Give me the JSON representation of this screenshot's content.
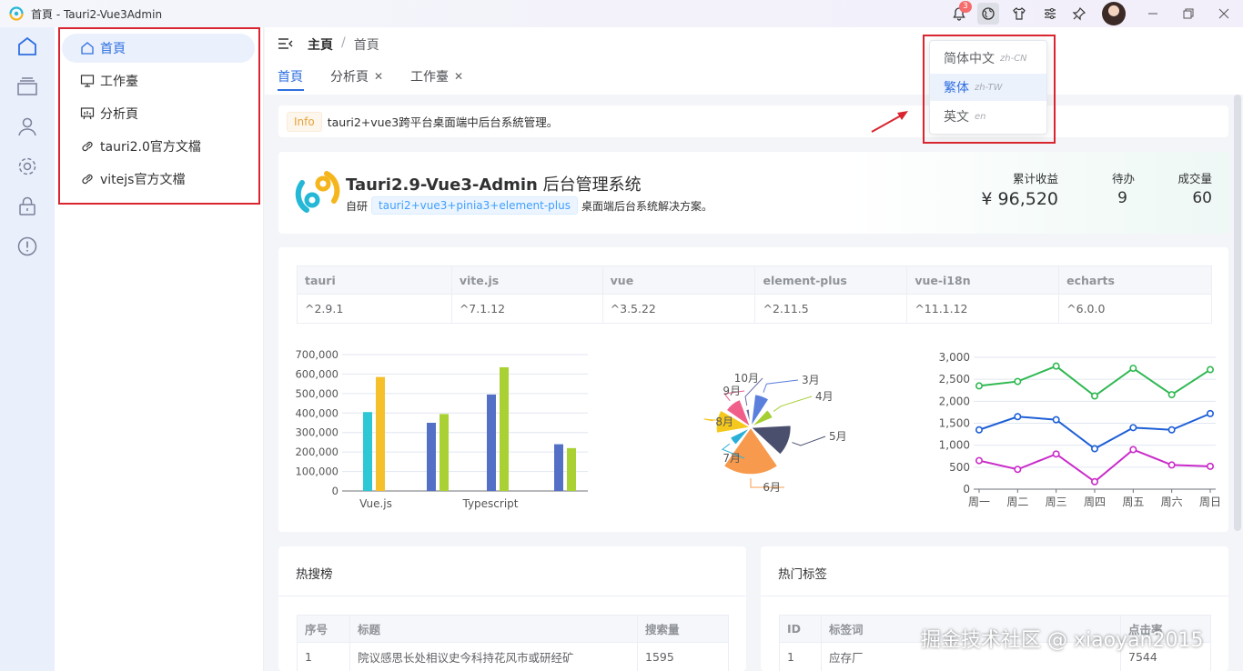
{
  "window": {
    "title": "首頁 - Tauri2-Vue3Admin",
    "notification_count": "3"
  },
  "sidebar": {
    "items": [
      {
        "label": "首頁",
        "icon": "home-icon"
      },
      {
        "label": "工作臺",
        "icon": "monitor-icon"
      },
      {
        "label": "分析頁",
        "icon": "chart-board-icon"
      },
      {
        "label": "tauri2.0官方文檔",
        "icon": "link-icon"
      },
      {
        "label": "vitejs官方文檔",
        "icon": "link-icon"
      }
    ]
  },
  "header": {
    "breadcrumb": {
      "root": "主頁",
      "separator": "/",
      "current": "首頁"
    },
    "tabs": [
      {
        "label": "首頁",
        "active": true
      },
      {
        "label": "分析頁",
        "close": "✕"
      },
      {
        "label": "工作臺",
        "close": "✕"
      }
    ]
  },
  "language_menu": {
    "items": [
      {
        "label": "简体中文",
        "code": "zh-CN"
      },
      {
        "label": "繁体",
        "code": "zh-TW",
        "active": true
      },
      {
        "label": "英文",
        "code": "en"
      }
    ]
  },
  "notice": {
    "tag": "Info",
    "text": "tauri2+vue3跨平台桌面端中后台系統管理。"
  },
  "banner": {
    "title_bold": "Tauri2.9-Vue3-Admin",
    "title_rest": "后台管理系统",
    "desc_prefix": "自研",
    "desc_tag": "tauri2+vue3+pinia3+element-plus",
    "desc_suffix": "桌面端后台系统解决方案。",
    "stats": [
      {
        "label": "累计收益",
        "value": "¥ 96,520"
      },
      {
        "label": "待办",
        "value": "9"
      },
      {
        "label": "成交量",
        "value": "60"
      }
    ]
  },
  "deps_table": {
    "headers": [
      "tauri",
      "vite.js",
      "vue",
      "element-plus",
      "vue-i18n",
      "echarts"
    ],
    "values": [
      "^2.9.1",
      "^7.1.12",
      "^3.5.22",
      "^2.11.5",
      "^11.1.12",
      "^6.0.0"
    ]
  },
  "chart_data": [
    {
      "type": "bar",
      "categories": [
        "Vue.js",
        "Typescript"
      ],
      "x_tick_labels": [
        "Vue.js",
        "Typescript"
      ],
      "ylim": [
        0,
        700000
      ],
      "y_ticks": [
        "0",
        "100,000",
        "200,000",
        "300,000",
        "400,000",
        "500,000",
        "600,000",
        "700,000"
      ],
      "series": [
        {
          "color": "#2ec7d6",
          "values": [
            405000
          ]
        },
        {
          "color": "#f5c02a",
          "values": [
            585000
          ]
        },
        {
          "color": "#5470c6",
          "values": [
            350000,
            495000,
            240000
          ]
        },
        {
          "color": "#a9d134",
          "values": [
            395000,
            635000,
            220000
          ]
        }
      ]
    },
    {
      "type": "pie",
      "rose": true,
      "categories": [
        "3月",
        "4月",
        "5月",
        "6月",
        "7月",
        "8月",
        "9月",
        "10月"
      ],
      "values": [
        36,
        20,
        48,
        60,
        18,
        38,
        30,
        10
      ],
      "colors": [
        "#5b7fdd",
        "#a6cf33",
        "#4a4f6e",
        "#f79a4d",
        "#2ab0d8",
        "#f5c81e",
        "#ef5f8a",
        "#6a6fa8"
      ]
    },
    {
      "type": "line",
      "categories": [
        "周一",
        "周二",
        "周三",
        "周四",
        "周五",
        "周六",
        "周日"
      ],
      "ylim": [
        0,
        3000
      ],
      "y_ticks": [
        "0",
        "500",
        "1,000",
        "1,500",
        "2,000",
        "2,500",
        "3,000"
      ],
      "series": [
        {
          "color": "#2fb851",
          "values": [
            2350,
            2450,
            2800,
            2120,
            2750,
            2150,
            2720
          ]
        },
        {
          "color": "#1d5fd6",
          "values": [
            1350,
            1650,
            1580,
            920,
            1400,
            1350,
            1720
          ]
        },
        {
          "color": "#c92bc9",
          "values": [
            650,
            450,
            800,
            170,
            900,
            550,
            520
          ]
        }
      ]
    }
  ],
  "hot_search": {
    "title": "热搜榜",
    "headers": [
      "序号",
      "标题",
      "搜索量"
    ],
    "rows": [
      [
        "1",
        "院议感思长处相议史今科持花风市或研经矿",
        "1595"
      ]
    ]
  },
  "hot_tags": {
    "title": "热门标签",
    "headers": [
      "ID",
      "标签词",
      "点击率"
    ],
    "rows": [
      [
        "1",
        "应存厂",
        "7544"
      ]
    ]
  },
  "watermark": "掘金技术社区 @ xiaoyan2015"
}
